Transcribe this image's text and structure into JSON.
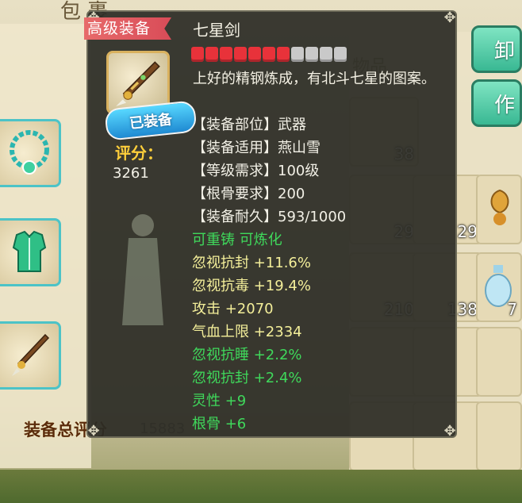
{
  "background": {
    "title_partial": "包   裹",
    "total_score_label": "装备总评分",
    "total_score_value": "15883",
    "side_buttons": [
      {
        "label": "卸"
      },
      {
        "label": "作"
      }
    ],
    "right_grid_tab_label": "物品",
    "grid_counts": [
      "38",
      "29",
      "29",
      "210",
      "138",
      "7"
    ]
  },
  "tooltip": {
    "quality_tag": "高级装备",
    "name": "七星剑",
    "stars": {
      "filled": 7,
      "total": 11,
      "filled_color": "#e8323a",
      "empty_color": "#c9c9c9"
    },
    "equipped_badge": "已装备",
    "score_label": "评分：",
    "score_value": "3261",
    "description": "上好的精钢炼成，有北斗七星的图案。",
    "attributes": [
      {
        "text": "【装备部位】武器",
        "color": "#f2f0e6"
      },
      {
        "text": "【装备适用】燕山雪",
        "color": "#f2f0e6"
      },
      {
        "text": "【等级需求】100级",
        "color": "#f2f0e6"
      },
      {
        "text": "【根骨要求】200",
        "color": "#f2f0e6"
      },
      {
        "text": "【装备耐久】593/1000",
        "color": "#f2f0e6"
      },
      {
        "text": "可重铸 可炼化",
        "color": "#3fd85b"
      },
      {
        "text": "忽视抗封 +11.6%",
        "color": "#f4ef9a"
      },
      {
        "text": "忽视抗毒 +19.4%",
        "color": "#f4ef9a"
      },
      {
        "text": "攻击 +2070",
        "color": "#f4ef9a"
      },
      {
        "text": "气血上限 +2334",
        "color": "#f4ef9a"
      },
      {
        "text": "忽视抗睡 +2.2%",
        "color": "#3fd85b"
      },
      {
        "text": "忽视抗封 +2.4%",
        "color": "#3fd85b"
      },
      {
        "text": "灵性 +9",
        "color": "#3fd85b"
      },
      {
        "text": "根骨 +6",
        "color": "#3fd85b"
      }
    ]
  }
}
